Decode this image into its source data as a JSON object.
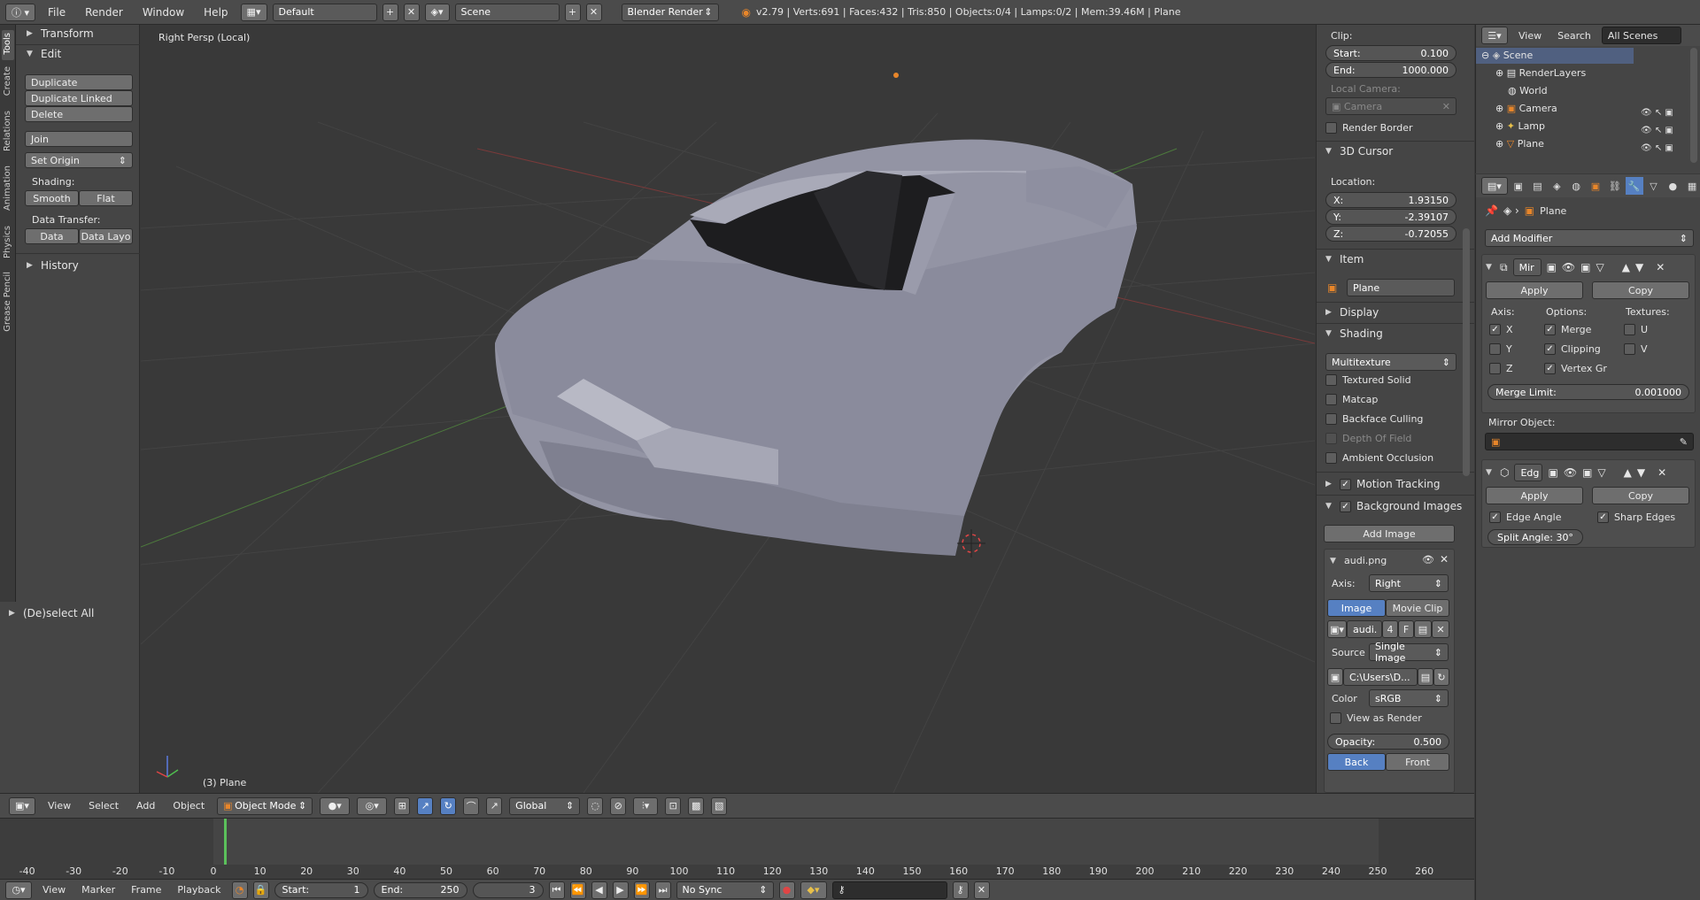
{
  "topbar": {
    "menus": [
      "File",
      "Render",
      "Window",
      "Help"
    ],
    "layout": "Default",
    "scene": "Scene",
    "engine": "Blender Render",
    "stats": "v2.79 | Verts:691 | Faces:432 | Tris:850 | Objects:0/4 | Lamps:0/2 | Mem:39.46M | Plane"
  },
  "tabs": [
    "Tools",
    "Create",
    "Relations",
    "Animation",
    "Physics",
    "Grease Pencil"
  ],
  "toolshelf": {
    "transform": "Transform",
    "edit": "Edit",
    "duplicate": "Duplicate",
    "duplicate_linked": "Duplicate Linked",
    "delete": "Delete",
    "join": "Join",
    "set_origin": "Set Origin",
    "shading_label": "Shading:",
    "smooth": "Smooth",
    "flat": "Flat",
    "data_transfer_label": "Data Transfer:",
    "data": "Data",
    "data_layo": "Data Layo",
    "history": "History",
    "deselect_all": "(De)select All"
  },
  "viewport": {
    "title": "Right Persp (Local)",
    "object_label": "(3) Plane"
  },
  "viewheader": {
    "view": "View",
    "select": "Select",
    "add": "Add",
    "object": "Object",
    "mode": "Object Mode",
    "orientation": "Global"
  },
  "nprops": {
    "clip": "Clip:",
    "start_label": "Start:",
    "start_val": "0.100",
    "end_label": "End:",
    "end_val": "1000.000",
    "local_camera": "Local Camera:",
    "camera": "Camera",
    "render_border": "Render Border",
    "cursor": "3D Cursor",
    "location": "Location:",
    "x_label": "X:",
    "x_val": "1.93150",
    "y_label": "Y:",
    "y_val": "-2.39107",
    "z_label": "Z:",
    "z_val": "-0.72055",
    "item": "Item",
    "item_name": "Plane",
    "display": "Display",
    "shading": "Shading",
    "multitexture": "Multitexture",
    "textured_solid": "Textured Solid",
    "matcap": "Matcap",
    "backface": "Backface Culling",
    "dof": "Depth Of Field",
    "ao": "Ambient Occlusion",
    "motion_tracking": "Motion Tracking",
    "bg_images": "Background Images",
    "add_image": "Add Image",
    "image_name": "audi.png",
    "axis_label": "Axis:",
    "axis_val": "Right",
    "image_tab": "Image",
    "movie_tab": "Movie Clip",
    "img_field": "audi.",
    "img_users": "4",
    "img_f": "F",
    "source_label": "Source",
    "source_val": "Single Image",
    "path": "C:\\Users\\D...",
    "color_label": "Color",
    "color_val": "sRGB",
    "view_as_render": "View as Render",
    "opacity_label": "Opacity:",
    "opacity_val": "0.500",
    "back": "Back",
    "front": "Front"
  },
  "outliner": {
    "view": "View",
    "search": "Search",
    "all_scenes": "All Scenes",
    "items": [
      "Scene",
      "RenderLayers",
      "World",
      "Camera",
      "Lamp",
      "Plane"
    ]
  },
  "properties": {
    "object_name": "Plane",
    "add_modifier": "Add Modifier",
    "mod1_name": "Mir",
    "apply": "Apply",
    "copy": "Copy",
    "axis": "Axis:",
    "options": "Options:",
    "textures": "Textures:",
    "x": "X",
    "y": "Y",
    "z": "Z",
    "merge": "Merge",
    "clipping": "Clipping",
    "vertex_gr": "Vertex Gr",
    "u": "U",
    "v": "V",
    "merge_limit_label": "Merge Limit:",
    "merge_limit_val": "0.001000",
    "mirror_object": "Mirror Object:",
    "mod2_name": "Edg",
    "edge_angle": "Edge Angle",
    "sharp_edges": "Sharp Edges",
    "split_angle": "Split Angle: 30°"
  },
  "timeline": {
    "ticks": [
      "-40",
      "-30",
      "-20",
      "-10",
      "0",
      "10",
      "20",
      "30",
      "40",
      "50",
      "60",
      "70",
      "80",
      "90",
      "100",
      "110",
      "120",
      "130",
      "140",
      "150",
      "160",
      "170",
      "180",
      "190",
      "200",
      "210",
      "220",
      "230",
      "240",
      "250",
      "260"
    ],
    "view": "View",
    "marker": "Marker",
    "frame": "Frame",
    "playback": "Playback",
    "start_label": "Start:",
    "start_val": "1",
    "end_label": "End:",
    "end_val": "250",
    "current": "3",
    "sync": "No Sync"
  }
}
